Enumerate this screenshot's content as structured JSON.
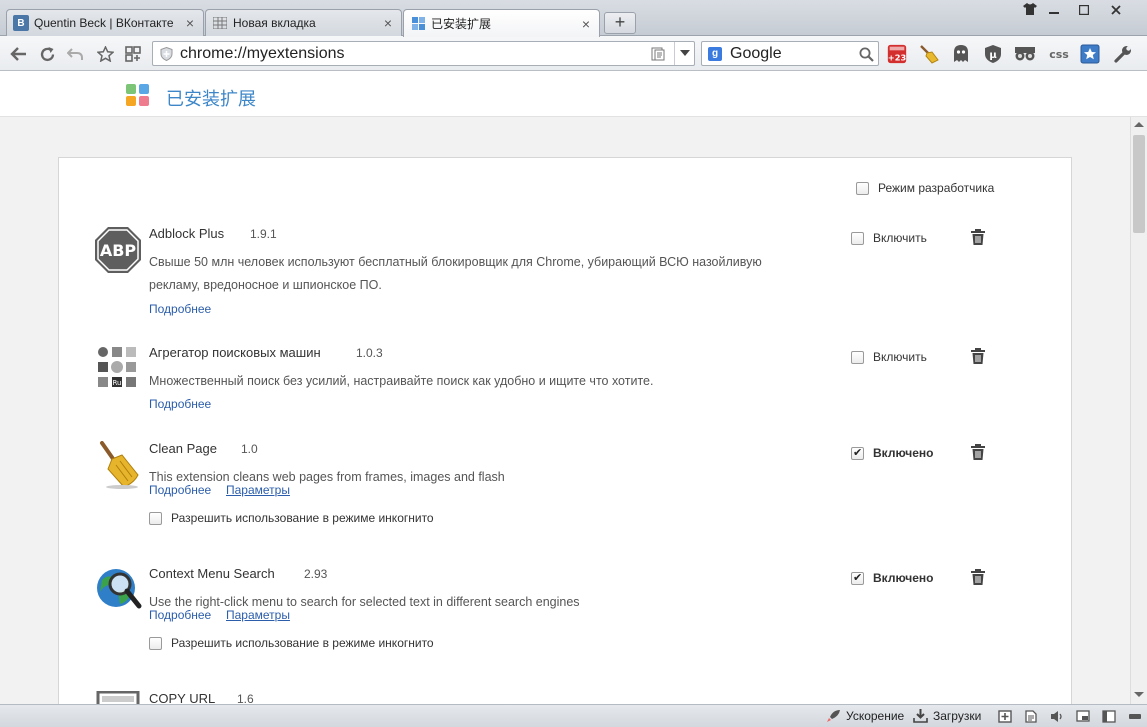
{
  "tabs": [
    {
      "label": "Quentin Beck | ВКонтакте",
      "favicon": "B"
    },
    {
      "label": "Новая вкладка"
    },
    {
      "label": "已安装扩展"
    }
  ],
  "address": {
    "url": "chrome://myextensions"
  },
  "search": {
    "engine": "Google"
  },
  "toolbar_badges": {
    "weather": "+23"
  },
  "toolbar_labels": {
    "css": "css"
  },
  "page": {
    "title": "已安装扩展"
  },
  "dev_mode": {
    "label": "Режим разработчика",
    "checked": false
  },
  "extensions": [
    {
      "name": "Adblock Plus",
      "version": "1.9.1",
      "description": "Свыше 50 млн человек используют бесплатный блокировщик для Chrome, убирающий ВСЮ назойливую рекламу, вредоносное и шпионское ПО.",
      "more": "Подробнее",
      "enable_label": "Включить",
      "enabled": false,
      "icon": "abp-icon",
      "icon_text": "ABP"
    },
    {
      "name": "Агрегатор поисковых машин",
      "version": "1.0.3",
      "description": "Множественный поиск без усилий, настраивайте поиск как удобно и ищите что хотите.",
      "more": "Подробнее",
      "enable_label": "Включить",
      "enabled": false,
      "icon": "search-aggregator-icon",
      "icon_text": "Ru"
    },
    {
      "name": "Clean Page",
      "version": "1.0",
      "description": "This extension cleans web pages from frames, images and flash",
      "more": "Подробнее",
      "options": "Параметры",
      "incognito": "Разрешить использование в режиме инкогнито",
      "enable_label": "Включено",
      "enabled": true,
      "icon": "broom-icon"
    },
    {
      "name": "Context Menu Search",
      "version": "2.93",
      "description": "Use the right-click menu to search for selected text in different search engines",
      "more": "Подробнее",
      "options": "Параметры",
      "incognito": "Разрешить использование в режиме инкогнито",
      "enable_label": "Включено",
      "enabled": true,
      "icon": "globe-magnifier-icon"
    },
    {
      "name": "COPY URL",
      "version": "1.6",
      "icon": "copy-url-icon"
    }
  ],
  "statusbar": {
    "acceleration": "Ускорение",
    "downloads": "Загрузки"
  },
  "colors": {
    "accent": "#3d87c9",
    "link": "#2b5dab"
  }
}
